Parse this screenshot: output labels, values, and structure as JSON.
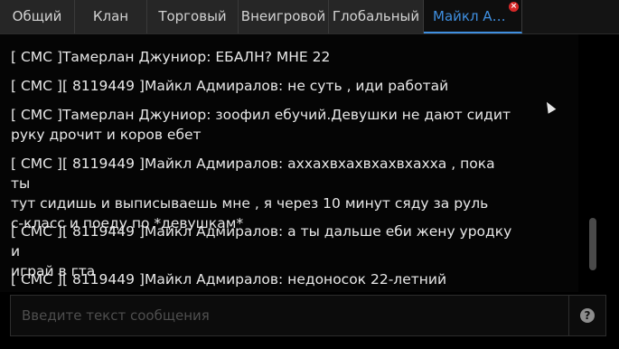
{
  "tabs": [
    {
      "label": "Общий"
    },
    {
      "label": "Клан"
    },
    {
      "label": "Торговый"
    },
    {
      "label": "Внеигровой"
    },
    {
      "label": "Глобальный"
    },
    {
      "label": "Майкл Ад..."
    }
  ],
  "tab_close_glyph": "×",
  "messages": [
    {
      "text": "[ СМС ]Тамерлан Джуниор: ЕБАЛН? МНЕ 22"
    },
    {
      "text": "[ СМС ][ 8119449 ]Майкл Адмиралов: не суть , иди работай"
    },
    {
      "text": "[ СМС ]Тамерлан Джуниор: зоофил ебучий.Девушки не дают сидит\nруку дрочит и коров ебет"
    },
    {
      "text": "[ СМС ][ 8119449 ]Майкл Адмиралов: аххахвхахвхахвхахха , пока ты\nтут сидишь и выписываешь мне , я через 10 минут сяду за руль\nс-класс и поеду по *девушкам*"
    },
    {
      "text": "[ СМС ][ 8119449 ]Майкл Адмиралов: а ты дальше еби жену уродку и\nиграй в гта"
    },
    {
      "text": "[ СМС ][ 8119449 ]Майкл Адмиралов: недоносок 22-летний"
    }
  ],
  "input": {
    "value": "",
    "placeholder": "Введите текст сообщения"
  },
  "help_glyph": "?"
}
